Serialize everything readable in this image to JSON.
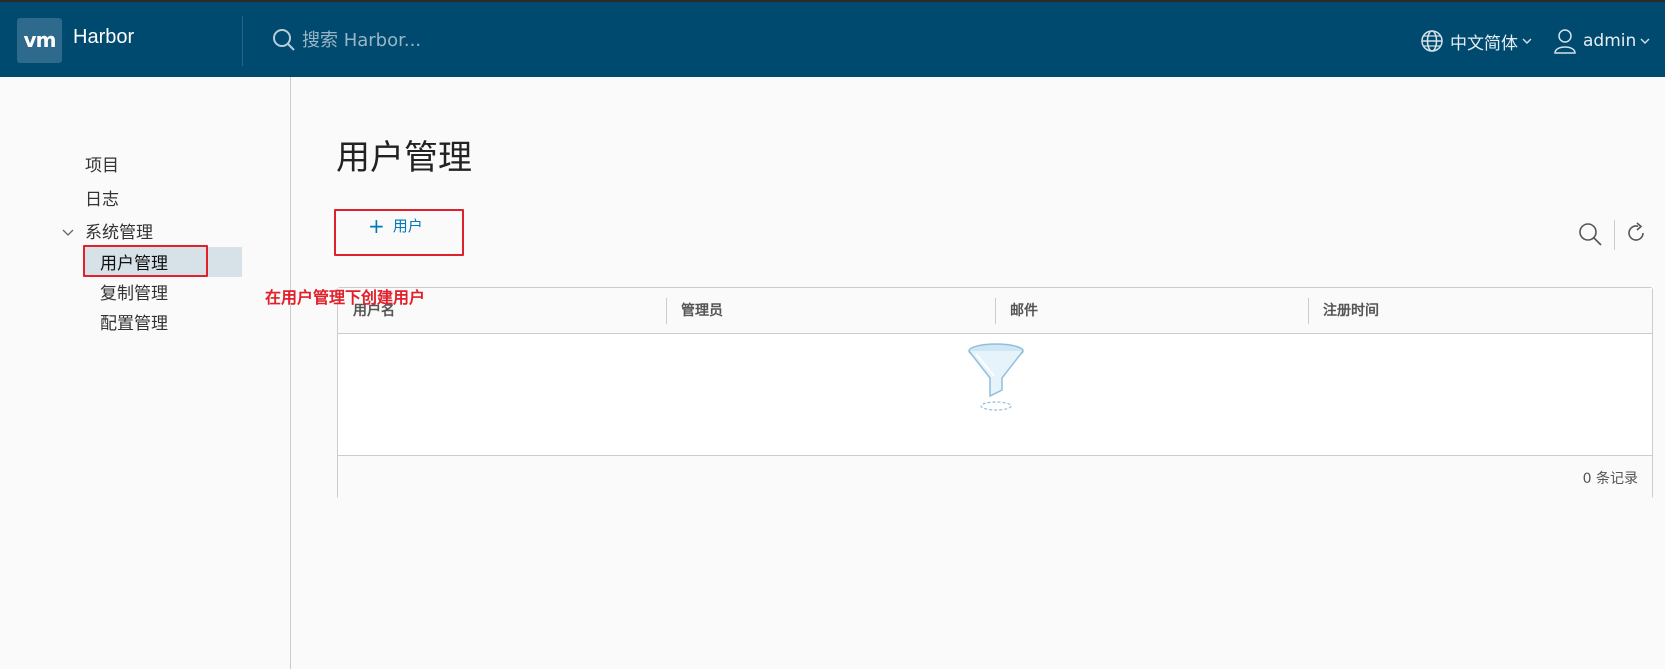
{
  "header": {
    "logo": "vm",
    "app_title": "Harbor",
    "search_placeholder": "搜索 Harbor...",
    "language": "中文简体",
    "user": "admin",
    "background_color": "#004a70"
  },
  "sidebar": {
    "items": [
      {
        "label": "项目"
      },
      {
        "label": "日志"
      },
      {
        "label": "系统管理",
        "expanded": true,
        "children": [
          {
            "label": "用户管理",
            "active": true
          },
          {
            "label": "复制管理"
          },
          {
            "label": "配置管理"
          }
        ]
      }
    ]
  },
  "annotation": {
    "text": "在用户管理下创建用户",
    "color": "#e0202a"
  },
  "main": {
    "title": "用户管理",
    "add_button_label": "用户",
    "table": {
      "columns": [
        "用户名",
        "管理员",
        "邮件",
        "注册时间"
      ],
      "rows": [],
      "footer": "0 条记录"
    }
  }
}
